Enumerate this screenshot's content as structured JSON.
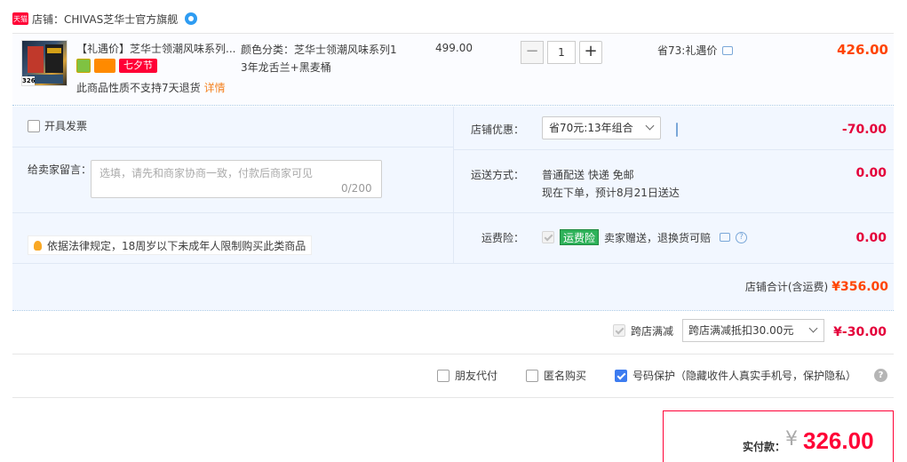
{
  "shop": {
    "badge": "天猫",
    "name": "店铺：CHIVAS芝华士官方旗舰"
  },
  "item": {
    "thumb_price": "326",
    "title": "【礼遇价】芝华士领潮风味系列...",
    "festival_badge": "七夕节",
    "no_return_text": "此商品性质不支持7天退货",
    "no_return_link": "详情",
    "sku_line1": "颜色分类：芝华士领潮风味系列1",
    "sku_line2": "3年龙舌兰+黑麦桶",
    "unit_price": "499.00",
    "quantity": "1",
    "qty_minus": "−",
    "qty_plus": "+",
    "saving": "省73:礼遇价",
    "total": "426.00"
  },
  "order": {
    "invoice_label": "开具发票",
    "message_label": "给卖家留言：",
    "message_placeholder": "选填，请先和商家协商一致，付款后商家可见",
    "message_count": "0/200",
    "law_tip": "依据法律规定，18周岁以下未成年人限制购买此类商品",
    "shop_promo_label": "店铺优惠：",
    "shop_promo_selected": "省70元:13年组合",
    "shop_promo_amount": "-70.00",
    "shipping_label": "运送方式：",
    "shipping_line1": "普通配送 快递 免邮",
    "shipping_line2": "现在下单，预计8月21日送达",
    "shipping_amount": "0.00",
    "insurance_label": "运费险：",
    "insurance_tag": "运费险",
    "insurance_text": "卖家赠送，退换货可赔",
    "insurance_amount": "0.00",
    "subtotal_label": "店铺合计(含运费)",
    "subtotal_amount": "¥356.00"
  },
  "cross_store": {
    "label": "跨店满减",
    "selected": "跨店满减抵扣30.00元",
    "amount": "¥-30.00"
  },
  "options": {
    "friend_pay": "朋友代付",
    "anonymous": "匿名购买",
    "number_protect": "号码保护（隐藏收件人真实手机号，保护隐私）"
  },
  "payment": {
    "label": "实付款：",
    "currency": "¥",
    "amount": "326.00"
  },
  "colors": {
    "accent": "#ff0036",
    "price": "#ff4400",
    "panel_bg": "#f2f7ff",
    "check_blue": "#3d7cf0"
  }
}
